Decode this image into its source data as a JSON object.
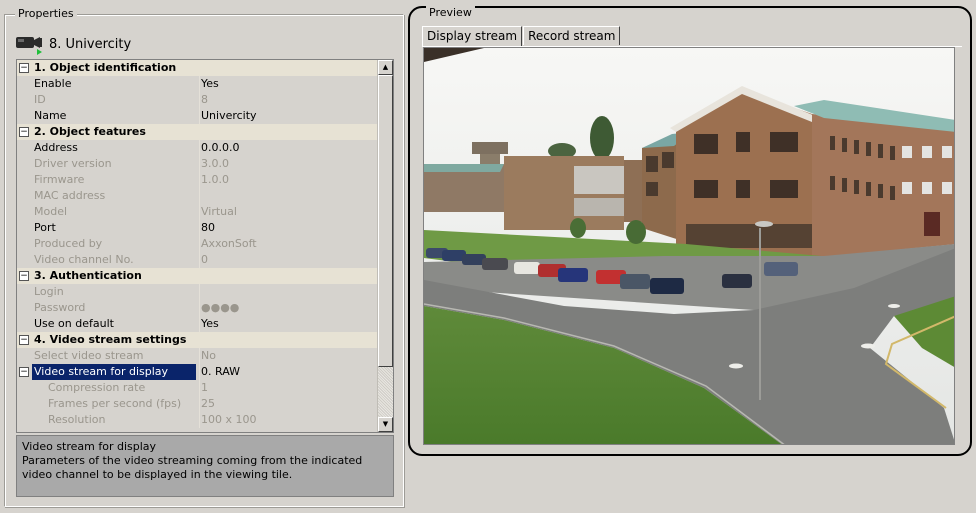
{
  "properties": {
    "group_title": "Properties",
    "device_title": "8. Univercity",
    "rows": [
      {
        "type": "category",
        "label": "1. Object identification",
        "toggle": "−"
      },
      {
        "type": "prop",
        "name": "Enable",
        "value": "Yes",
        "dim": false
      },
      {
        "type": "prop",
        "name": "ID",
        "value": "8",
        "dim": true
      },
      {
        "type": "prop",
        "name": "Name",
        "value": "Univercity",
        "dim": false
      },
      {
        "type": "category",
        "label": "2. Object features",
        "toggle": "−"
      },
      {
        "type": "prop",
        "name": "Address",
        "value": "0.0.0.0",
        "dim": false
      },
      {
        "type": "prop",
        "name": "Driver version",
        "value": "3.0.0",
        "dim": true
      },
      {
        "type": "prop",
        "name": "Firmware",
        "value": "1.0.0",
        "dim": true
      },
      {
        "type": "prop",
        "name": "MAC address",
        "value": "",
        "dim": true
      },
      {
        "type": "prop",
        "name": "Model",
        "value": "Virtual",
        "dim": true
      },
      {
        "type": "prop",
        "name": "Port",
        "value": "80",
        "dim": false
      },
      {
        "type": "prop",
        "name": "Produced by",
        "value": "AxxonSoft",
        "dim": true
      },
      {
        "type": "prop",
        "name": "Video channel No.",
        "value": "0",
        "dim": true
      },
      {
        "type": "category",
        "label": "3. Authentication",
        "toggle": "−"
      },
      {
        "type": "prop",
        "name": "Login",
        "value": "",
        "dim": true
      },
      {
        "type": "prop",
        "name": "Password",
        "value": "●●●●",
        "dim": true
      },
      {
        "type": "prop",
        "name": "Use on default",
        "value": "Yes",
        "dim": false
      },
      {
        "type": "category",
        "label": "4. Video stream settings",
        "toggle": "−"
      },
      {
        "type": "prop",
        "name": "Select video stream",
        "value": "No",
        "dim": true
      },
      {
        "type": "prop",
        "name": "Video stream for display",
        "value": "0. RAW",
        "dim": false,
        "selected": true,
        "toggle": "−"
      },
      {
        "type": "prop",
        "name": "Compression rate",
        "value": "1",
        "dim": true,
        "sub": true
      },
      {
        "type": "prop",
        "name": "Frames per second (fps)",
        "value": "25",
        "dim": true,
        "sub": true
      },
      {
        "type": "prop",
        "name": "Resolution",
        "value": "100 x 100",
        "dim": true,
        "sub": true
      }
    ],
    "description": {
      "title": "Video stream for display",
      "text": "Parameters of the video streaming coming from the indicated video channel to be displayed in the viewing tile."
    }
  },
  "preview": {
    "group_title": "Preview",
    "tabs": [
      {
        "label": "Display stream",
        "active": true
      },
      {
        "label": "Record stream",
        "active": false
      }
    ]
  },
  "colors": {
    "background": "#d6d3ce",
    "selection": "#0a246a",
    "category_bg": "#e7e2d4",
    "dim_text": "#9a968d",
    "description_bg": "#a9a9a9",
    "camera_led": "#1fbf3a"
  }
}
